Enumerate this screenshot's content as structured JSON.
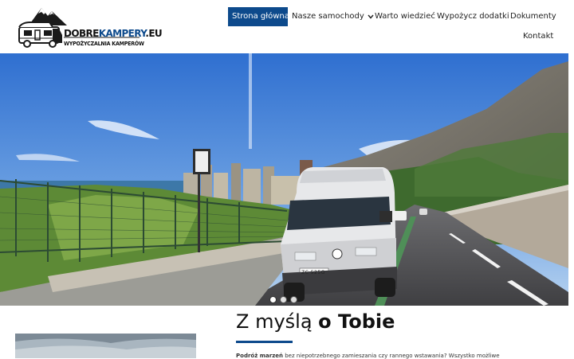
{
  "brand": {
    "name_part1": "DOBRE",
    "name_part2": "KAMPERY",
    "name_part3": ".EU",
    "tagline": "WYPOŻYCZALNIA KAMPERÓW"
  },
  "nav": {
    "items": [
      {
        "label": "Strona główna",
        "active": true
      },
      {
        "label": "Nasze samochody",
        "has_dropdown": true
      },
      {
        "label": "Warto wiedzieć"
      },
      {
        "label": "Wypożycz dodatki"
      },
      {
        "label": "Dokumenty"
      },
      {
        "label": "Kontakt"
      }
    ]
  },
  "hero": {
    "slide_count": 3,
    "active_slide": 1,
    "plate_text": "ZC 525G"
  },
  "section": {
    "heading_part1": "Z myślą ",
    "heading_part2": "o Tobie",
    "paragraph_bold": "Podróż marzeń",
    "paragraph_rest": " bez niepotrzebnego zamieszania czy rannego wstawania? Wszystko możliwe"
  },
  "colors": {
    "accent": "#0d4a8c",
    "nav_active_bg": "#0d4a8c",
    "nav_active_text": "#ffffff"
  },
  "icons": [
    "chevron-down-icon",
    "mountain-camper-logo-icon"
  ]
}
